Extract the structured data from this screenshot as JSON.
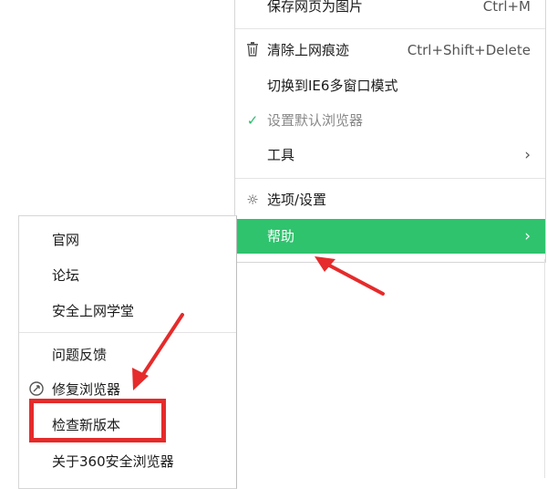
{
  "main_menu": {
    "items": [
      {
        "label": "保存网页为图片",
        "shortcut": "Ctrl+M"
      },
      {
        "label": "清除上网痕迹",
        "shortcut": "Ctrl+Shift+Delete",
        "icon": "trash-icon"
      },
      {
        "label": "切换到IE6多窗口模式"
      },
      {
        "label": "设置默认浏览器",
        "icon": "checkmark-icon",
        "state": "disabled"
      },
      {
        "label": "工具",
        "submenu": true
      },
      {
        "label": "选项/设置",
        "icon": "gear-icon"
      },
      {
        "label": "帮助",
        "submenu": true,
        "state": "highlighted"
      }
    ]
  },
  "help_submenu": {
    "items": [
      {
        "label": "官网"
      },
      {
        "label": "论坛"
      },
      {
        "label": "安全上网学堂"
      },
      {
        "label": "问题反馈"
      },
      {
        "label": "修复浏览器",
        "icon": "repair-icon"
      },
      {
        "label": "检查新版本",
        "annotation": "red-highlight-box"
      },
      {
        "label": "关于360安全浏览器"
      }
    ]
  },
  "colors": {
    "highlight_green": "#2fc36e",
    "annotation_red": "#e52b2b",
    "check_green": "#26c06a"
  }
}
